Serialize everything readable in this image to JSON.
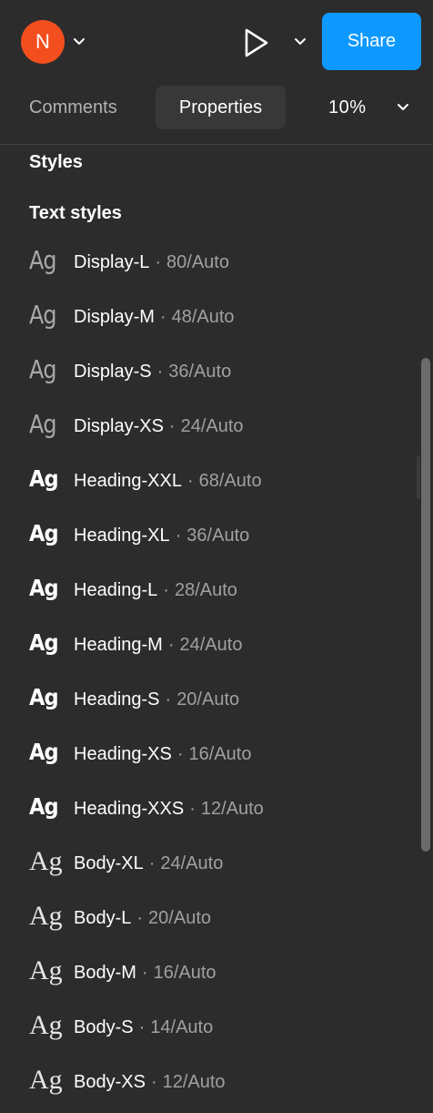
{
  "header": {
    "avatar_initial": "N",
    "share_label": "Share",
    "colors": {
      "avatar": "#f24e1e",
      "share": "#0d99ff"
    }
  },
  "tabs": {
    "comments_label": "Comments",
    "properties_label": "Properties",
    "active": "Properties"
  },
  "zoom": {
    "value": "10%"
  },
  "sections": {
    "styles_title": "Styles",
    "text_styles_title": "Text styles"
  },
  "text_styles": [
    {
      "preview": "Ag",
      "weight": "light",
      "name": "Display-L",
      "spec": "80/Auto"
    },
    {
      "preview": "Ag",
      "weight": "light",
      "name": "Display-M",
      "spec": "48/Auto"
    },
    {
      "preview": "Ag",
      "weight": "light",
      "name": "Display-S",
      "spec": "36/Auto"
    },
    {
      "preview": "Ag",
      "weight": "light",
      "name": "Display-XS",
      "spec": "24/Auto"
    },
    {
      "preview": "Ag",
      "weight": "bold",
      "name": "Heading-XXL",
      "spec": "68/Auto"
    },
    {
      "preview": "Ag",
      "weight": "bold",
      "name": "Heading-XL",
      "spec": "36/Auto"
    },
    {
      "preview": "Ag",
      "weight": "bold",
      "name": "Heading-L",
      "spec": "28/Auto"
    },
    {
      "preview": "Ag",
      "weight": "bold",
      "name": "Heading-M",
      "spec": "24/Auto"
    },
    {
      "preview": "Ag",
      "weight": "bold",
      "name": "Heading-S",
      "spec": "20/Auto"
    },
    {
      "preview": "Ag",
      "weight": "bold",
      "name": "Heading-XS",
      "spec": "16/Auto"
    },
    {
      "preview": "Ag",
      "weight": "bold",
      "name": "Heading-XXS",
      "spec": "12/Auto"
    },
    {
      "preview": "Ag",
      "weight": "regular",
      "name": "Body-XL",
      "spec": "24/Auto"
    },
    {
      "preview": "Ag",
      "weight": "regular",
      "name": "Body-L",
      "spec": "20/Auto"
    },
    {
      "preview": "Ag",
      "weight": "regular",
      "name": "Body-M",
      "spec": "16/Auto"
    },
    {
      "preview": "Ag",
      "weight": "regular",
      "name": "Body-S",
      "spec": "14/Auto"
    },
    {
      "preview": "Ag",
      "weight": "regular",
      "name": "Body-XS",
      "spec": "12/Auto"
    }
  ],
  "separator": "·",
  "icons": {
    "avatar_menu": "chevron-down-icon",
    "present": "play-icon",
    "present_menu": "chevron-down-icon",
    "zoom_menu": "chevron-down-icon"
  }
}
